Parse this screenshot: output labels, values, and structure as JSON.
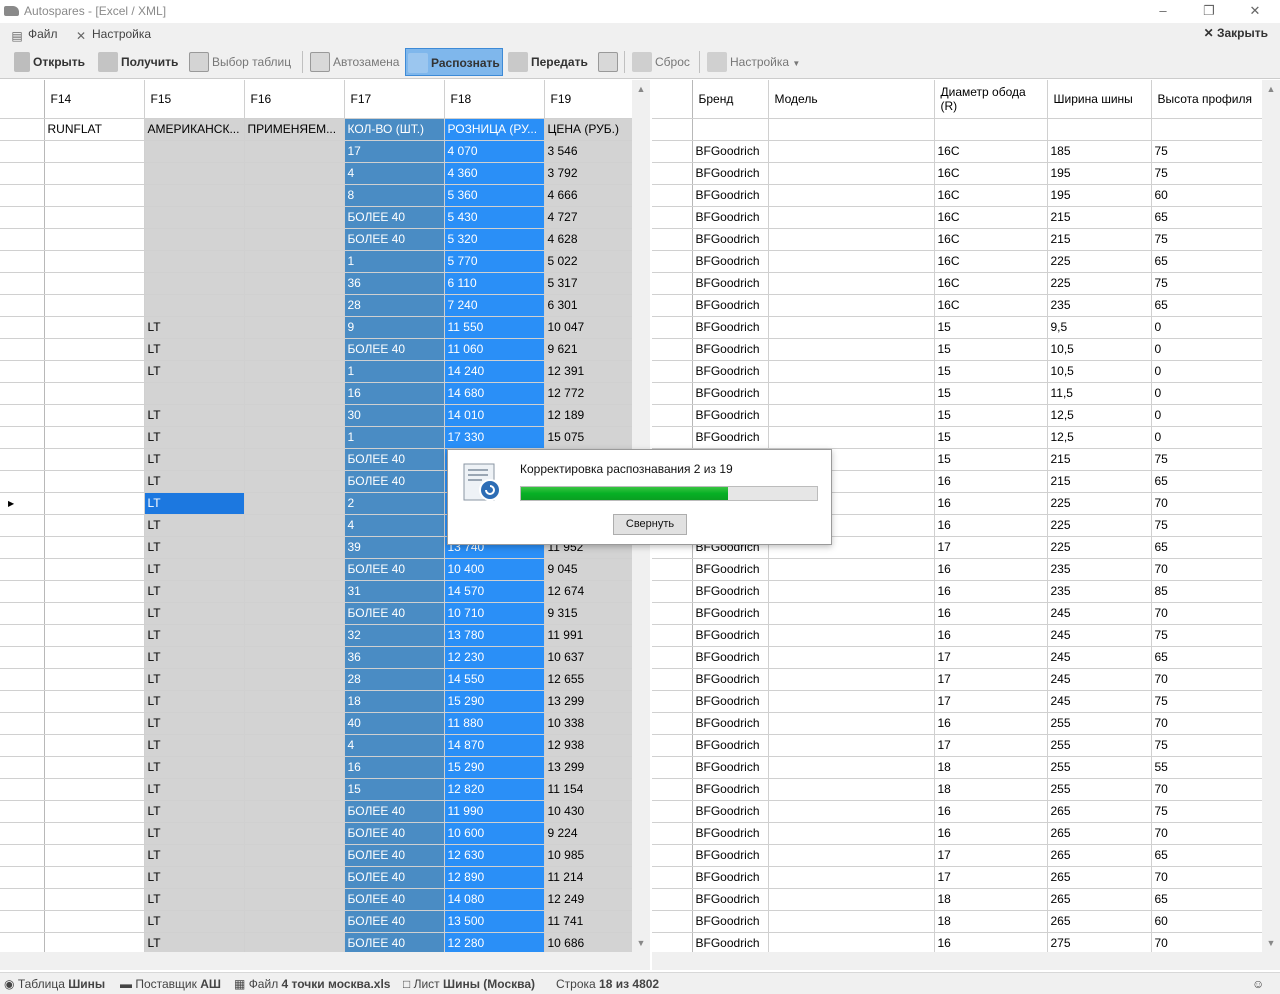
{
  "window": {
    "title": "Autospares - [Excel / XML]"
  },
  "menu": {
    "file": "Файл",
    "settings": "Настройка",
    "close": "Закрыть"
  },
  "toolbar": {
    "open": "Открыть",
    "receive": "Получить",
    "select_tables": "Выбор таблиц",
    "autoreplace": "Автозамена",
    "recognize": "Распознать",
    "send": "Передать",
    "reset": "Сброс",
    "settings": "Настройка"
  },
  "left_grid": {
    "headers": [
      "F14",
      "F15",
      "F16",
      "F17",
      "F18",
      "F19"
    ],
    "subheader": [
      "RUNFLAT",
      "АМЕРИКАНСК...",
      "ПРИМЕНЯЕМ...",
      "КОЛ-ВО (ШТ.)",
      "РОЗНИЦА (РУ...",
      "ЦЕНА (РУБ.)"
    ],
    "rows": [
      [
        "",
        "",
        "",
        "17",
        "4 070",
        "3 546"
      ],
      [
        "",
        "",
        "",
        "4",
        "4 360",
        "3 792"
      ],
      [
        "",
        "",
        "",
        "8",
        "5 360",
        "4 666"
      ],
      [
        "",
        "",
        "",
        "БОЛЕЕ 40",
        "5 430",
        "4 727"
      ],
      [
        "",
        "",
        "",
        "БОЛЕЕ 40",
        "5 320",
        "4 628"
      ],
      [
        "",
        "",
        "",
        "1",
        "5 770",
        "5 022"
      ],
      [
        "",
        "",
        "",
        "36",
        "6 110",
        "5 317"
      ],
      [
        "",
        "",
        "",
        "28",
        "7 240",
        "6 301"
      ],
      [
        "",
        "LT",
        "",
        "9",
        "11 550",
        "10 047"
      ],
      [
        "",
        "LT",
        "",
        "БОЛЕЕ 40",
        "11 060",
        "9 621"
      ],
      [
        "",
        "LT",
        "",
        "1",
        "14 240",
        "12 391"
      ],
      [
        "",
        "",
        "",
        "16",
        "14 680",
        "12 772"
      ],
      [
        "",
        "LT",
        "",
        "30",
        "14 010",
        "12 189"
      ],
      [
        "",
        "LT",
        "",
        "1",
        "17 330",
        "15 075"
      ],
      [
        "",
        "LT",
        "",
        "БОЛЕЕ 40",
        "",
        ""
      ],
      [
        "",
        "LT",
        "",
        "БОЛЕЕ 40",
        "",
        ""
      ],
      [
        "",
        "LT",
        "",
        "2",
        "",
        ""
      ],
      [
        "",
        "LT",
        "",
        "4",
        "",
        ""
      ],
      [
        "",
        "LT",
        "",
        "39",
        "13 740",
        "11 952"
      ],
      [
        "",
        "LT",
        "",
        "БОЛЕЕ 40",
        "10 400",
        "9 045"
      ],
      [
        "",
        "LT",
        "",
        "31",
        "14 570",
        "12 674"
      ],
      [
        "",
        "LT",
        "",
        "БОЛЕЕ 40",
        "10 710",
        "9 315"
      ],
      [
        "",
        "LT",
        "",
        "32",
        "13 780",
        "11 991"
      ],
      [
        "",
        "LT",
        "",
        "36",
        "12 230",
        "10 637"
      ],
      [
        "",
        "LT",
        "",
        "28",
        "14 550",
        "12 655"
      ],
      [
        "",
        "LT",
        "",
        "18",
        "15 290",
        "13 299"
      ],
      [
        "",
        "LT",
        "",
        "40",
        "11 880",
        "10 338"
      ],
      [
        "",
        "LT",
        "",
        "4",
        "14 870",
        "12 938"
      ],
      [
        "",
        "LT",
        "",
        "16",
        "15 290",
        "13 299"
      ],
      [
        "",
        "LT",
        "",
        "15",
        "12 820",
        "11 154"
      ],
      [
        "",
        "LT",
        "",
        "БОЛЕЕ 40",
        "11 990",
        "10 430"
      ],
      [
        "",
        "LT",
        "",
        "БОЛЕЕ 40",
        "10 600",
        "9 224"
      ],
      [
        "",
        "LT",
        "",
        "БОЛЕЕ 40",
        "12 630",
        "10 985"
      ],
      [
        "",
        "LT",
        "",
        "БОЛЕЕ 40",
        "12 890",
        "11 214"
      ],
      [
        "",
        "LT",
        "",
        "БОЛЕЕ 40",
        "14 080",
        "12 249"
      ],
      [
        "",
        "LT",
        "",
        "БОЛЕЕ 40",
        "13 500",
        "11 741"
      ],
      [
        "",
        "LT",
        "",
        "БОЛЕЕ 40",
        "12 280",
        "10 686"
      ]
    ]
  },
  "right_grid": {
    "headers": [
      "Бренд",
      "Модель",
      "Диаметр обода (R)",
      "Ширина шины",
      "Высота профиля"
    ],
    "rows": [
      [
        "BFGoodrich",
        "",
        "16C",
        "185",
        "75"
      ],
      [
        "BFGoodrich",
        "",
        "16C",
        "195",
        "75"
      ],
      [
        "BFGoodrich",
        "",
        "16C",
        "195",
        "60"
      ],
      [
        "BFGoodrich",
        "",
        "16C",
        "215",
        "65"
      ],
      [
        "BFGoodrich",
        "",
        "16C",
        "215",
        "75"
      ],
      [
        "BFGoodrich",
        "",
        "16C",
        "225",
        "65"
      ],
      [
        "BFGoodrich",
        "",
        "16C",
        "225",
        "75"
      ],
      [
        "BFGoodrich",
        "",
        "16C",
        "235",
        "65"
      ],
      [
        "BFGoodrich",
        "",
        "15",
        "9,5",
        "0"
      ],
      [
        "BFGoodrich",
        "",
        "15",
        "10,5",
        "0"
      ],
      [
        "BFGoodrich",
        "",
        "15",
        "10,5",
        "0"
      ],
      [
        "BFGoodrich",
        "",
        "15",
        "11,5",
        "0"
      ],
      [
        "BFGoodrich",
        "",
        "15",
        "12,5",
        "0"
      ],
      [
        "BFGoodrich",
        "",
        "15",
        "12,5",
        "0"
      ],
      [
        "",
        "",
        "15",
        "215",
        "75"
      ],
      [
        "",
        "",
        "16",
        "215",
        "65"
      ],
      [
        "",
        "",
        "16",
        "225",
        "70"
      ],
      [
        "",
        "",
        "16",
        "225",
        "75"
      ],
      [
        "BFGoodrich",
        "",
        "17",
        "225",
        "65"
      ],
      [
        "BFGoodrich",
        "",
        "16",
        "235",
        "70"
      ],
      [
        "BFGoodrich",
        "",
        "16",
        "235",
        "85"
      ],
      [
        "BFGoodrich",
        "",
        "16",
        "245",
        "70"
      ],
      [
        "BFGoodrich",
        "",
        "16",
        "245",
        "75"
      ],
      [
        "BFGoodrich",
        "",
        "17",
        "245",
        "65"
      ],
      [
        "BFGoodrich",
        "",
        "17",
        "245",
        "70"
      ],
      [
        "BFGoodrich",
        "",
        "17",
        "245",
        "75"
      ],
      [
        "BFGoodrich",
        "",
        "16",
        "255",
        "70"
      ],
      [
        "BFGoodrich",
        "",
        "17",
        "255",
        "75"
      ],
      [
        "BFGoodrich",
        "",
        "18",
        "255",
        "55"
      ],
      [
        "BFGoodrich",
        "",
        "18",
        "255",
        "70"
      ],
      [
        "BFGoodrich",
        "",
        "16",
        "265",
        "75"
      ],
      [
        "BFGoodrich",
        "",
        "16",
        "265",
        "70"
      ],
      [
        "BFGoodrich",
        "",
        "17",
        "265",
        "65"
      ],
      [
        "BFGoodrich",
        "",
        "17",
        "265",
        "70"
      ],
      [
        "BFGoodrich",
        "",
        "18",
        "265",
        "65"
      ],
      [
        "BFGoodrich",
        "",
        "18",
        "265",
        "60"
      ],
      [
        "BFGoodrich",
        "",
        "16",
        "275",
        "70"
      ]
    ]
  },
  "dialog": {
    "message": "Корректировка распознавания 2 из 19",
    "progress": 0.7,
    "button": "Свернуть"
  },
  "status": {
    "table_label": "Таблица",
    "table_value": "Шины",
    "supplier_label": "Поставщик",
    "supplier_value": "АШ",
    "file_label": "Файл",
    "file_value": "4 точки москва.xls",
    "sheet_label": "Лист",
    "sheet_value": "Шины (Москва)",
    "row_label": "Строка",
    "row_value": "18 из 4802"
  },
  "colors": {
    "qty_column": "#4a8cc4",
    "retail_column": "#2a8ff7",
    "gray_column": "#d3d3d3",
    "selected_cell": "#1c78e0",
    "progress": "#06b025"
  }
}
